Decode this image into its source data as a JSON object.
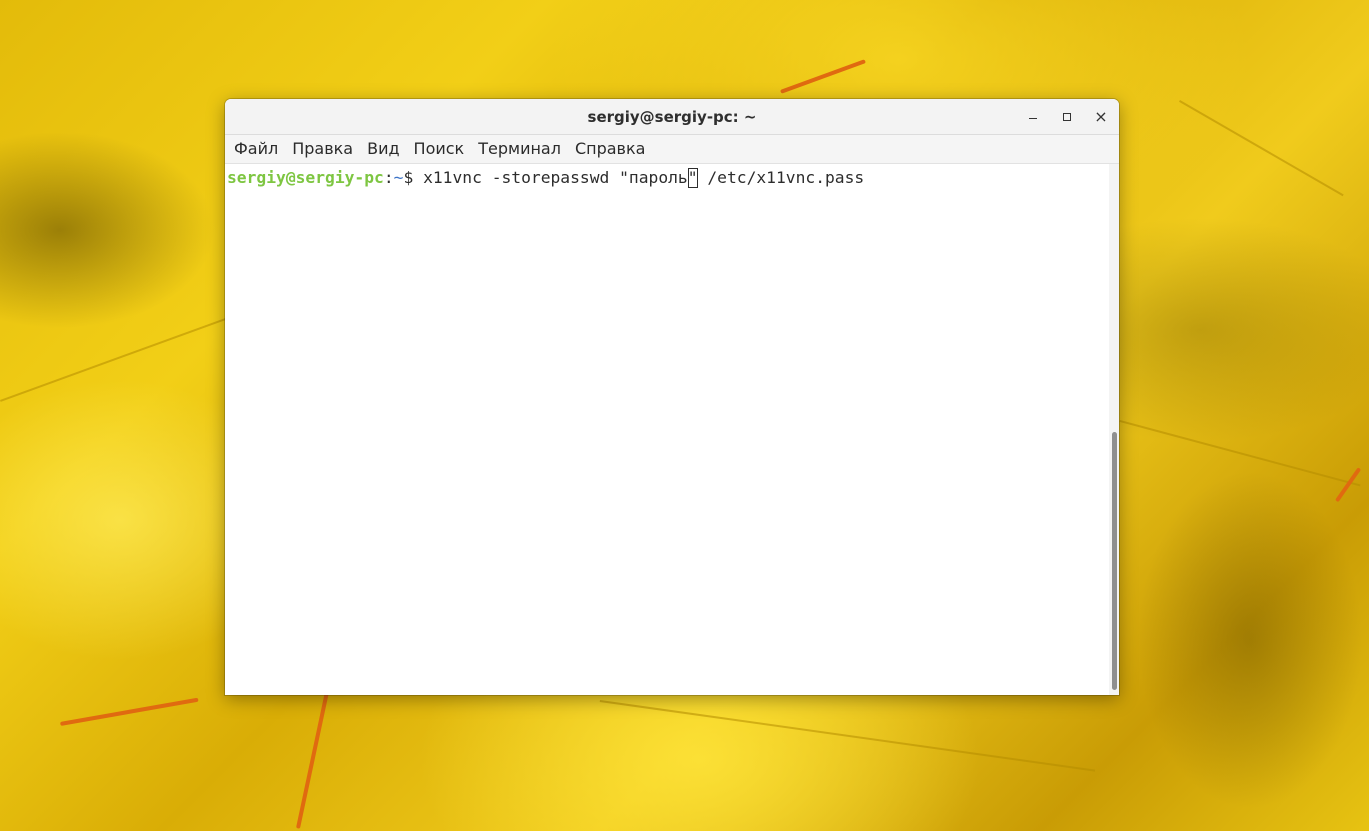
{
  "window": {
    "title": "sergiy@sergiy-pc: ~",
    "controls": {
      "minimize_icon": "minimize-icon",
      "maximize_icon": "maximize-icon",
      "close_icon": "close-icon",
      "close_glyph": "×"
    }
  },
  "menubar": {
    "items": [
      {
        "label": "Файл"
      },
      {
        "label": "Правка"
      },
      {
        "label": "Вид"
      },
      {
        "label": "Поиск"
      },
      {
        "label": "Терминал"
      },
      {
        "label": "Справка"
      }
    ]
  },
  "terminal": {
    "prompt_user": "sergiy@sergiy-pc",
    "prompt_sep": ":",
    "prompt_path": "~",
    "prompt_symbol": "$ ",
    "command_before_cursor": "x11vnc -storepasswd \"пароль",
    "cursor_char": "\"",
    "command_after_cursor": " /etc/x11vnc.pass"
  },
  "colors": {
    "prompt_user": "#7ec642",
    "prompt_path": "#3b73c7",
    "text": "#2d2d2d",
    "background": "#ffffff"
  }
}
